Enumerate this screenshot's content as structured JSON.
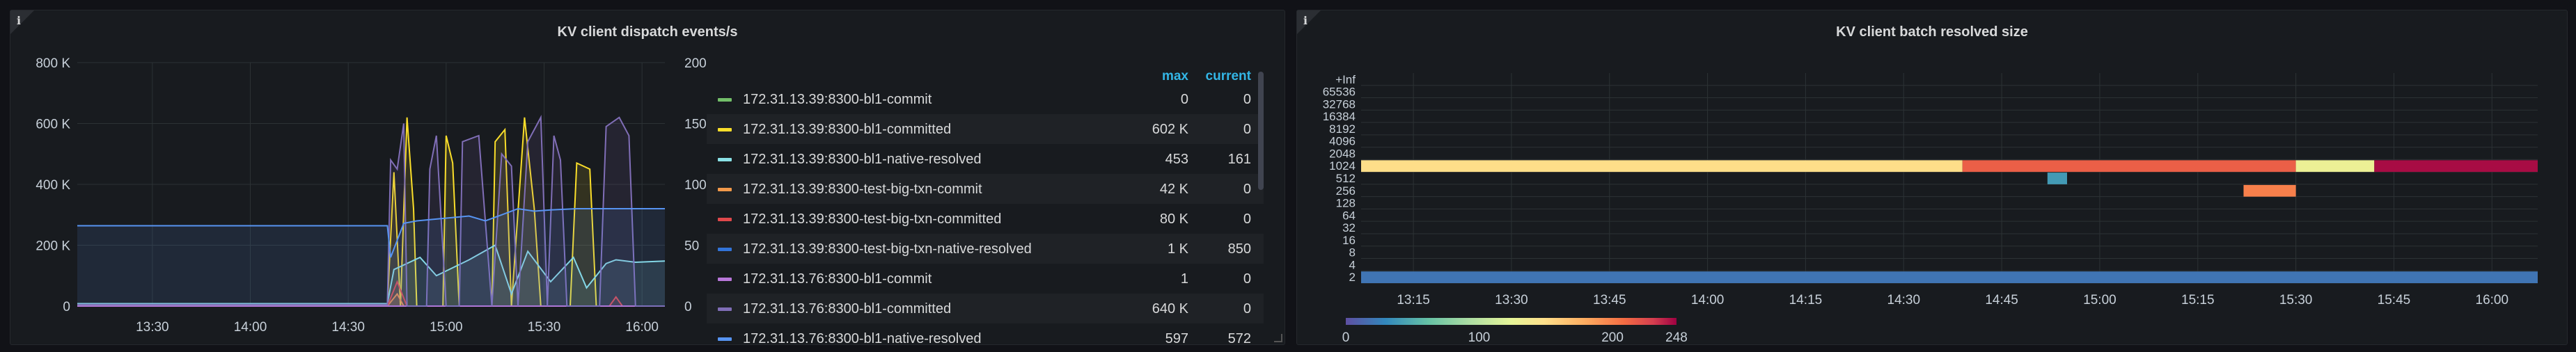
{
  "colors": {
    "background": "#111217",
    "panel": "#181b1f",
    "legend_header": "#33b5e5",
    "grid": "#2c3235",
    "axis_text": "#c7d0d9"
  },
  "panels": {
    "left": {
      "title": "KV client dispatch events/s",
      "info_icon": "info-icon",
      "legend": {
        "header_max": "max",
        "header_current": "current",
        "items": [
          {
            "name": "172.31.13.39:8300-bl1-commit",
            "max": "0",
            "current": "0",
            "color": "#73bf69"
          },
          {
            "name": "172.31.13.39:8300-bl1-committed",
            "max": "602 K",
            "current": "0",
            "color": "#fade2a"
          },
          {
            "name": "172.31.13.39:8300-bl1-native-resolved",
            "max": "453",
            "current": "161",
            "color": "#8ae1e6"
          },
          {
            "name": "172.31.13.39:8300-test-big-txn-commit",
            "max": "42 K",
            "current": "0",
            "color": "#f2994a"
          },
          {
            "name": "172.31.13.39:8300-test-big-txn-committed",
            "max": "80 K",
            "current": "0",
            "color": "#e0484b"
          },
          {
            "name": "172.31.13.39:8300-test-big-txn-native-resolved",
            "max": "1 K",
            "current": "850",
            "color": "#3274d9"
          },
          {
            "name": "172.31.13.76:8300-bl1-commit",
            "max": "1",
            "current": "0",
            "color": "#b877d9"
          },
          {
            "name": "172.31.13.76:8300-bl1-committed",
            "max": "640 K",
            "current": "0",
            "color": "#806eb7"
          },
          {
            "name": "172.31.13.76:8300-bl1-native-resolved",
            "max": "597",
            "current": "572",
            "color": "#5794f2"
          }
        ]
      }
    },
    "right": {
      "title": "KV client batch resolved size",
      "info_icon": "info-icon"
    }
  },
  "chart_data": [
    {
      "type": "line",
      "title": "KV client dispatch events/s",
      "x_ticks": [
        "13:30",
        "14:00",
        "14:30",
        "15:00",
        "15:30",
        "16:00"
      ],
      "x_range": [
        "13:07",
        "16:07"
      ],
      "y_left_ticks": [
        "0",
        "200 K",
        "400 K",
        "600 K",
        "800 K"
      ],
      "y_left_range": [
        0,
        800000
      ],
      "y_right_ticks": [
        "0",
        "50",
        "100",
        "150",
        "200"
      ],
      "y_right_range": [
        0,
        200
      ],
      "grid": true,
      "legend_position": "right",
      "series": [
        {
          "name": "172.31.13.39:8300-bl1-commit",
          "color": "#73bf69",
          "values": [
            [
              0,
              0
            ],
            [
              180,
              0
            ]
          ]
        },
        {
          "name": "172.31.13.39:8300-bl1-committed",
          "color": "#fade2a",
          "values": [
            [
              0,
              5000
            ],
            [
              95,
              5000
            ],
            [
              97,
              440000
            ],
            [
              99,
              0
            ],
            [
              101,
              620000
            ],
            [
              103,
              320000
            ],
            [
              104,
              0
            ],
            [
              112,
              0
            ],
            [
              113,
              560000
            ],
            [
              115,
              470000
            ],
            [
              117,
              0
            ],
            [
              127,
              0
            ],
            [
              128,
              540000
            ],
            [
              131,
              580000
            ],
            [
              133,
              0
            ],
            [
              137,
              620000
            ],
            [
              140,
              320000
            ],
            [
              142,
              0
            ],
            [
              151,
              0
            ],
            [
              153,
              470000
            ],
            [
              157,
              450000
            ],
            [
              159,
              0
            ],
            [
              180,
              0
            ]
          ]
        },
        {
          "name": "172.31.13.39:8300-bl1-native-resolved",
          "color": "#8ae1e6",
          "values": [
            [
              0,
              2
            ],
            [
              95,
              2
            ],
            [
              97,
              30
            ],
            [
              105,
              40
            ],
            [
              110,
              25
            ],
            [
              120,
              38
            ],
            [
              128,
              50
            ],
            [
              133,
              10
            ],
            [
              138,
              45
            ],
            [
              145,
              20
            ],
            [
              152,
              40
            ],
            [
              156,
              15
            ],
            [
              162,
              35
            ],
            [
              165,
              38
            ],
            [
              171,
              36
            ],
            [
              180,
              37
            ]
          ]
        },
        {
          "name": "172.31.13.39:8300-test-big-txn-commit",
          "color": "#f2994a",
          "values": [
            [
              0,
              0
            ],
            [
              95,
              0
            ],
            [
              98,
              40000
            ],
            [
              100,
              0
            ],
            [
              180,
              0
            ]
          ]
        },
        {
          "name": "172.31.13.39:8300-test-big-txn-committed",
          "color": "#e0484b",
          "values": [
            [
              0,
              0
            ],
            [
              95,
              0
            ],
            [
              98,
              80000
            ],
            [
              101,
              0
            ],
            [
              163,
              0
            ],
            [
              165,
              30000
            ],
            [
              167,
              0
            ],
            [
              180,
              0
            ]
          ]
        },
        {
          "name": "172.31.13.39:8300-test-big-txn-native-resolved",
          "color": "#3274d9",
          "values": [
            [
              0,
              0
            ],
            [
              180,
              0
            ]
          ]
        },
        {
          "name": "172.31.13.76:8300-bl1-commit",
          "color": "#b877d9",
          "values": [
            [
              0,
              0
            ],
            [
              180,
              0
            ]
          ]
        },
        {
          "name": "172.31.13.76:8300-bl1-committed",
          "color": "#806eb7",
          "values": [
            [
              0,
              5000
            ],
            [
              95,
              5000
            ],
            [
              96,
              480000
            ],
            [
              98,
              450000
            ],
            [
              100,
              600000
            ],
            [
              101,
              0
            ],
            [
              107,
              0
            ],
            [
              108,
              450000
            ],
            [
              110,
              560000
            ],
            [
              113,
              0
            ],
            [
              117,
              0
            ],
            [
              118,
              540000
            ],
            [
              123,
              560000
            ],
            [
              127,
              0
            ],
            [
              130,
              500000
            ],
            [
              133,
              460000
            ],
            [
              135,
              0
            ],
            [
              138,
              540000
            ],
            [
              142,
              620000
            ],
            [
              144,
              0
            ],
            [
              146,
              560000
            ],
            [
              148,
              480000
            ],
            [
              150,
              0
            ],
            [
              160,
              0
            ],
            [
              162,
              590000
            ],
            [
              166,
              620000
            ],
            [
              169,
              560000
            ],
            [
              171,
              0
            ],
            [
              180,
              0
            ]
          ]
        },
        {
          "name": "172.31.13.76:8300-bl1-native-resolved",
          "color": "#5794f2",
          "values": [
            [
              0,
              66
            ],
            [
              95,
              66
            ],
            [
              96,
              40
            ],
            [
              100,
              68
            ],
            [
              104,
              70
            ],
            [
              112,
              72
            ],
            [
              120,
              74
            ],
            [
              125,
              70
            ],
            [
              130,
              75
            ],
            [
              135,
              80
            ],
            [
              140,
              78
            ],
            [
              145,
              79
            ],
            [
              153,
              80
            ],
            [
              160,
              80
            ],
            [
              166,
              80
            ],
            [
              170,
              80
            ],
            [
              180,
              80
            ]
          ]
        }
      ]
    },
    {
      "type": "heatmap",
      "title": "KV client batch resolved size",
      "x_ticks": [
        "13:15",
        "13:30",
        "13:45",
        "14:00",
        "14:15",
        "14:30",
        "14:45",
        "15:00",
        "15:15",
        "15:30",
        "15:45",
        "16:00"
      ],
      "y_buckets": [
        "2",
        "4",
        "8",
        "16",
        "32",
        "64",
        "128",
        "256",
        "512",
        "1024",
        "2048",
        "4096",
        "8192",
        "16384",
        "32768",
        "65536",
        "+Inf"
      ],
      "color_scale": {
        "min": 0,
        "max": 248,
        "ticks": [
          "0",
          "100",
          "200",
          "248"
        ],
        "scheme": "spectral"
      },
      "grid": true,
      "bands": [
        {
          "bucket": "1024",
          "from": "13:07",
          "to": "14:39",
          "level": 150
        },
        {
          "bucket": "1024",
          "from": "14:39",
          "to": "15:30",
          "level": 215
        },
        {
          "bucket": "1024",
          "from": "15:30",
          "to": "15:42",
          "level": 130
        },
        {
          "bucket": "1024",
          "from": "15:42",
          "to": "16:07",
          "level": 245
        },
        {
          "bucket": "512",
          "from": "14:52",
          "to": "14:55",
          "level": 40
        },
        {
          "bucket": "256",
          "from": "15:22",
          "to": "15:30",
          "level": 200
        },
        {
          "bucket": "2",
          "from": "13:07",
          "to": "16:07",
          "level": 20
        }
      ]
    }
  ]
}
